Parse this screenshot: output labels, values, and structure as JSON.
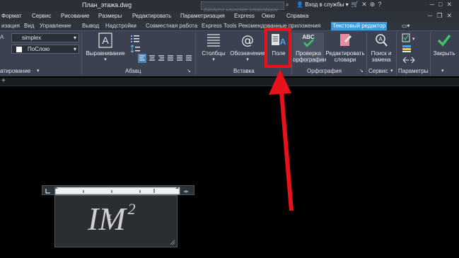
{
  "titlebar": {
    "title": "План_этажа.dwg",
    "search_placeholder": "Введите ключевое слово/фразу",
    "user_label": "Вход в службы"
  },
  "menu": [
    "Формат",
    "Сервис",
    "Рисование",
    "Размеры",
    "Редактировать",
    "Параметризация",
    "Express",
    "Окно",
    "Справка"
  ],
  "tabs": [
    "изация",
    "Вид",
    "Управление",
    "Вывод",
    "Надстройки",
    "Совместная работа",
    "Express Tools",
    "Рекомендованные приложения",
    "Текстовый редактор"
  ],
  "active_tab": "Текстовый редактор",
  "ribbon": {
    "style_value": "simplex",
    "layer_value": "ПоСлою",
    "panels": {
      "formatting": "атирование",
      "paragraph": "Абзац",
      "insert": "Вставка",
      "spelling": "Орфография",
      "tools": "Сервис",
      "options": "Параметры"
    },
    "buttons": {
      "justify": "Выравнивание",
      "columns": "Столбцы",
      "symbol": "Обозначение",
      "field": "Поле",
      "spell_check_1": "Проверка",
      "spell_check_2": "орфографии",
      "edit_dict_1": "Редактировать",
      "edit_dict_2": "словари",
      "find_1": "Поиск и",
      "find_2": "замена",
      "close": "Закрыть"
    }
  },
  "editor_text": {
    "main": "IM",
    "superscript": "2",
    "cursor_glyph": "I"
  },
  "colors": {
    "highlight": "#e8121b",
    "arrow": "#e8121b",
    "active_tab": "#3a9bdc",
    "ribbon_bg": "#3b4150"
  }
}
